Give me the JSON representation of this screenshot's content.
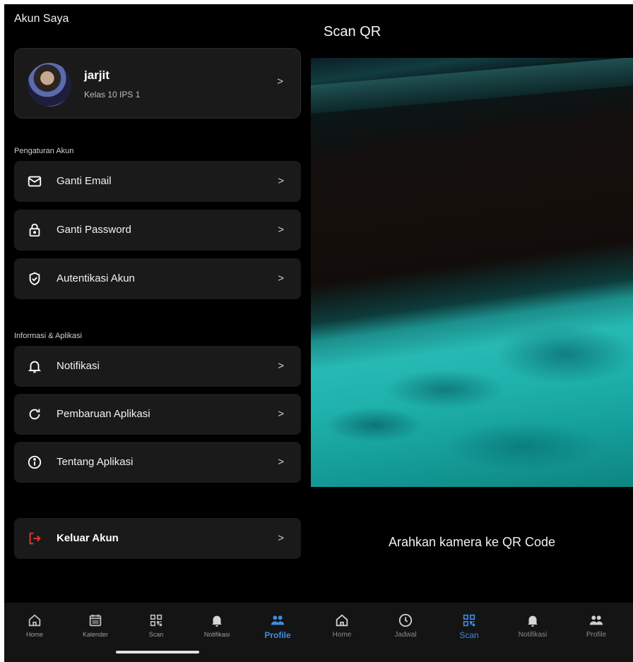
{
  "profile_screen": {
    "title": "Akun Saya",
    "user": {
      "name": "jarjit",
      "class": "Kelas 10 IPS 1"
    },
    "sections": [
      {
        "label": "Pengaturan Akun",
        "items": [
          {
            "label": "Ganti Email",
            "icon": "mail-icon"
          },
          {
            "label": "Ganti Password",
            "icon": "lock-icon"
          },
          {
            "label": "Autentikasi Akun",
            "icon": "shield-check-icon"
          }
        ]
      },
      {
        "label": "Informasi & Aplikasi",
        "items": [
          {
            "label": "Notifikasi",
            "icon": "bell-icon"
          },
          {
            "label": "Pembaruan Aplikasi",
            "icon": "refresh-icon"
          },
          {
            "label": "Tentang Aplikasi",
            "icon": "info-icon"
          }
        ]
      }
    ],
    "logout": {
      "label": "Keluar Akun",
      "icon": "logout-icon",
      "color": "#e53935"
    },
    "chevron": ">",
    "nav": [
      {
        "label": "Home",
        "icon": "home-icon"
      },
      {
        "label": "Kalender",
        "icon": "calendar-icon"
      },
      {
        "label": "Scan",
        "icon": "qr-icon"
      },
      {
        "label": "Notifikasi",
        "icon": "bell-icon"
      },
      {
        "label": "Profile",
        "icon": "people-icon",
        "active": true
      }
    ]
  },
  "scan_screen": {
    "title": "Scan QR",
    "hint": "Arahkan kamera ke QR Code",
    "nav": [
      {
        "label": "Home",
        "icon": "home-icon"
      },
      {
        "label": "Jadwal",
        "icon": "clock-icon"
      },
      {
        "label": "Scan",
        "icon": "qr-icon",
        "active": true
      },
      {
        "label": "Notifikasi",
        "icon": "bell-icon"
      },
      {
        "label": "Profile",
        "icon": "people-icon"
      }
    ]
  },
  "colors": {
    "accent": "#3c8ce8",
    "card": "#1a1a1a",
    "background": "#000000",
    "logout": "#e53935"
  }
}
